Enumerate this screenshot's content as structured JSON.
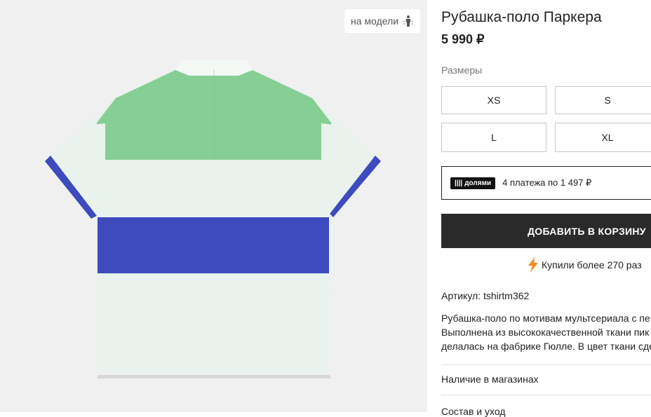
{
  "gallery": {
    "model_button_label": "на модели",
    "image_alt": "Рубашка-поло Паркера",
    "colors": {
      "green": "#86cf94",
      "blue": "#3d4bbf",
      "white": "#e9f2ec"
    }
  },
  "product": {
    "title": "Рубашка-поло Паркера",
    "price": "5 990 ₽",
    "sizes_label": "Размеры",
    "sizes": [
      "XS",
      "S",
      "L",
      "XL"
    ],
    "dolyami": {
      "logo": "долями",
      "text": "4 платежа по 1 497 ₽"
    },
    "add_to_cart": "ДОБАВИТЬ В КОРЗИНУ",
    "bought": "Купили более 270 раз",
    "article": "Артикул: tshirtm362",
    "description_lines": [
      "Рубашка-поло по мотивам мультсериала с пе",
      "Выполнена из высококачественной ткани пик",
      "делалась на фабрике Гюлле. В цвет ткани сде"
    ],
    "accordion": [
      "Наличие в магазинах",
      "Состав и уход"
    ]
  },
  "theme": {
    "button_bg": "#2a2a2a",
    "accent_bolt": "#f28c1e"
  }
}
